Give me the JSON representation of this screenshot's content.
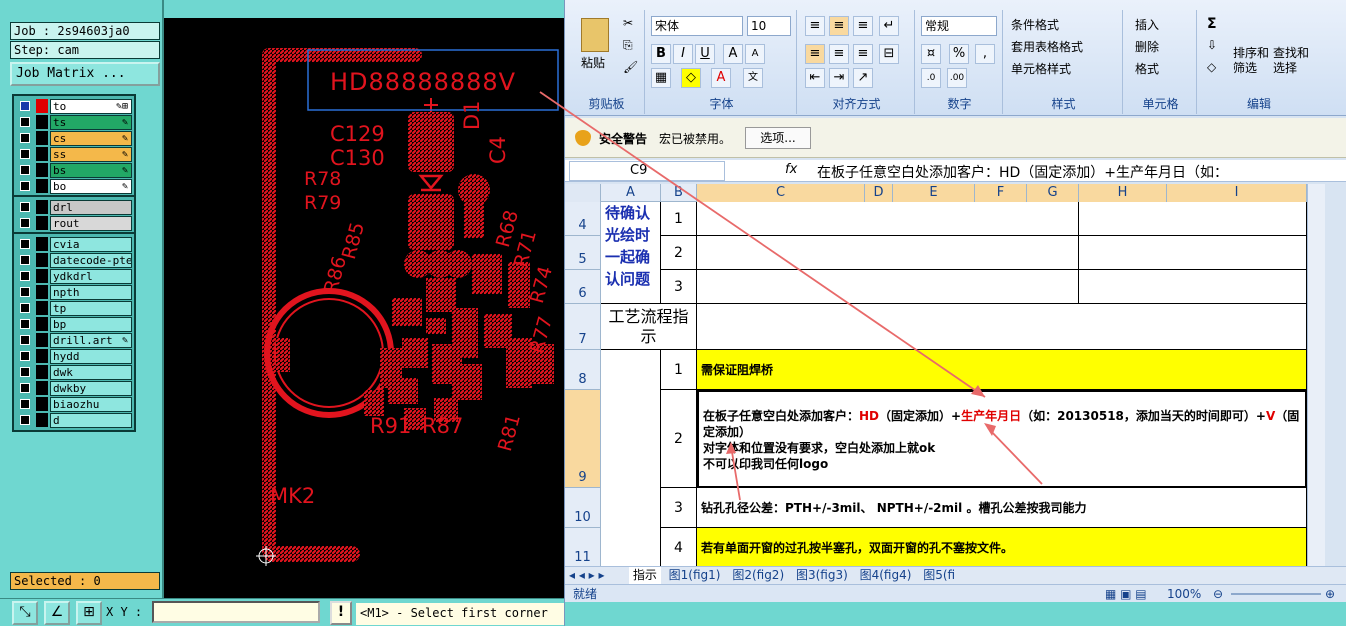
{
  "cam": {
    "job": "Job : 2s94603ja0",
    "step": "Step: cam",
    "job_matrix": "Job Matrix ...",
    "layers_group1": [
      {
        "name": "to",
        "bg": "#ffffff",
        "mark": "✎⊞",
        "active": true,
        "swatch": "#e00000"
      },
      {
        "name": "ts",
        "bg": "#22a866",
        "mark": "✎"
      },
      {
        "name": "cs",
        "bg": "#f4b84a",
        "mark": "✎"
      },
      {
        "name": "ss",
        "bg": "#f4b84a",
        "mark": "✎"
      },
      {
        "name": "bs",
        "bg": "#22a866",
        "mark": "✎"
      },
      {
        "name": "bo",
        "bg": "#ffffff",
        "mark": "✎"
      }
    ],
    "layers_group2": [
      {
        "name": "drl",
        "bg": "#c8c8c8"
      },
      {
        "name": "rout",
        "bg": "#d8d8d8"
      }
    ],
    "layers_group3": [
      {
        "name": "cvia",
        "bg": "#8ee6df"
      },
      {
        "name": "datecode-pte",
        "bg": "#8ee6df"
      },
      {
        "name": "ydkdrl",
        "bg": "#8ee6df"
      },
      {
        "name": "npth",
        "bg": "#8ee6df"
      },
      {
        "name": "tp",
        "bg": "#8ee6df"
      },
      {
        "name": "bp",
        "bg": "#8ee6df"
      },
      {
        "name": "drill.art",
        "bg": "#8ee6df",
        "mark": "✎"
      },
      {
        "name": "hydd",
        "bg": "#8ee6df"
      },
      {
        "name": "dwk",
        "bg": "#8ee6df"
      },
      {
        "name": "dwkby",
        "bg": "#8ee6df"
      },
      {
        "name": "biaozhu",
        "bg": "#8ee6df"
      },
      {
        "name": "d",
        "bg": "#8ee6df"
      }
    ],
    "selected": "Selected : 0",
    "xy_label": "X Y :",
    "xy_value": "",
    "message": "<M1> - Select first corner",
    "warn": "!"
  },
  "pcb": {
    "silk_texts": [
      "HD88888888V",
      "C129",
      "C130",
      "D1",
      "C4",
      "R78",
      "R79",
      "R85",
      "R86",
      "R68",
      "R71",
      "R74",
      "R77",
      "R81",
      "R91",
      "R87",
      "MK2"
    ],
    "highlight_color": "#2a6fd6",
    "copper_color": "#e1141e"
  },
  "excel": {
    "ribbon": {
      "paste": "粘贴",
      "clipboard_label": "剪贴板",
      "font_name": "宋体",
      "font_size": "10",
      "font_label": "字体",
      "align_label": "对齐方式",
      "number_format": "常规",
      "number_label": "数字",
      "cond_format": "条件格式",
      "table_format": "套用表格格式",
      "cell_style": "单元格样式",
      "styles_label": "样式",
      "insert": "插入",
      "delete": "删除",
      "format": "格式",
      "cells_label": "单元格",
      "sort_filter": "排序和\n筛选",
      "find_select": "查找和\n选择",
      "edit_label": "编辑",
      "pct": "%",
      "comma": ","
    },
    "security": {
      "title": "安全警告",
      "text": "宏已被禁用。",
      "options": "选项..."
    },
    "name_box": "C9",
    "fx": "fx",
    "formula": "在板子任意空白处添加客户：HD（固定添加）+生产年月日（如：",
    "columns": [
      "A",
      "B",
      "C",
      "D",
      "E",
      "F",
      "G",
      "H",
      "I"
    ],
    "rows": [
      "4",
      "5",
      "6",
      "7",
      "8",
      "9",
      "10",
      "11"
    ],
    "cells": {
      "a4_6": "待确认光绘时一起确认问题",
      "b4": "1",
      "b5": "2",
      "b6": "3",
      "a7": "工艺流程指示",
      "b8": "1",
      "c8": "需保证阻焊桥",
      "b9": "2",
      "c9_pre": "在板子任意空白处添加客户：",
      "c9_hd": "HD",
      "c9_mid": "（固定添加）+",
      "c9_date": "生产年月日",
      "c9_post": "（如：20130518，添加当天的时间即可）+",
      "c9_v": "V",
      "c9_end": "（固定添加）",
      "c9_line2": "对字体和位置没有要求，空白处添加上就ok",
      "c9_line3": "不可以印我司任何logo",
      "b10": "3",
      "c10": "钻孔孔径公差：PTH+/-3mil、 NPTH+/-2mil 。槽孔公差按我司能力",
      "b11": "4",
      "c11": "若有单面开窗的过孔按半塞孔，双面开窗的孔不塞按文件。"
    },
    "tabs": [
      "指示",
      "图1(fig1)",
      "图2(fig2)",
      "图3(fig3)",
      "图4(fig4)",
      "图5(fi"
    ],
    "status": "就绪",
    "zoom": "100%",
    "colors": {
      "yellow": "#ffff00",
      "red_text": "#e00000",
      "blue_text": "#1a2fb0",
      "selection": "#f9d99f"
    }
  }
}
